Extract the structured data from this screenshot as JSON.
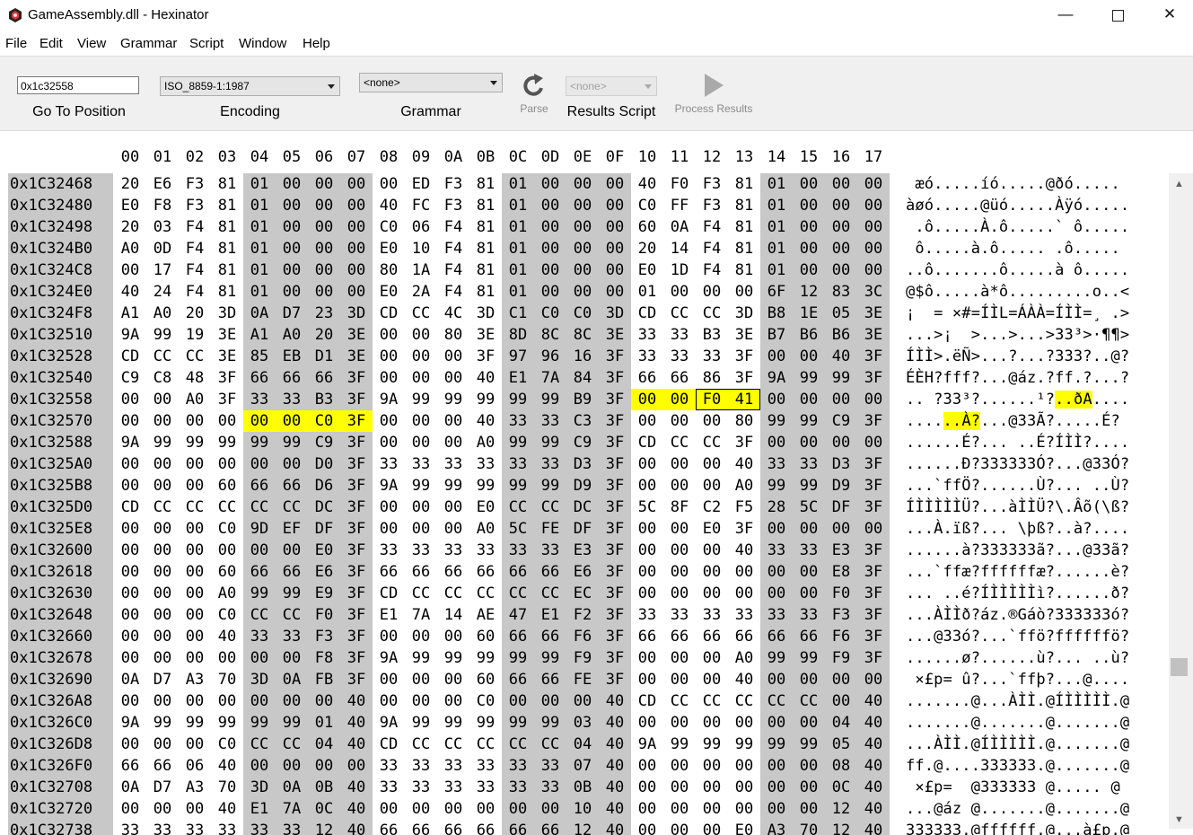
{
  "window": {
    "title": "GameAssembly.dll - Hexinator",
    "minimize": "—",
    "close": "✕"
  },
  "menu": [
    "File",
    "Edit",
    "View",
    "Grammar",
    "Script",
    "Window",
    "Help"
  ],
  "toolbar": {
    "goto_value": "0x1c32558",
    "goto_label": "Go To Position",
    "encoding_value": "ISO_8859-1:1987",
    "encoding_label": "Encoding",
    "grammar_value": "<none>",
    "grammar_label": "Grammar",
    "parse_label": "Parse",
    "results_script_value": "<none>",
    "results_script_label": "Results Script",
    "process_label": "Process Results"
  },
  "hex": {
    "columns": [
      "00",
      "01",
      "02",
      "03",
      "04",
      "05",
      "06",
      "07",
      "08",
      "09",
      "0A",
      "0B",
      "0C",
      "0D",
      "0E",
      "0F",
      "10",
      "11",
      "12",
      "13",
      "14",
      "15",
      "16",
      "17"
    ],
    "rows": [
      {
        "addr": "0x1C32468",
        "bytes": "20 E6 F3 81 01 00 00 00 00 ED F3 81 01 00 00 00 40 F0 F3 81 01 00 00 00",
        "ascii": " æó.....íó.....@ðó....."
      },
      {
        "addr": "0x1C32480",
        "bytes": "E0 F8 F3 81 01 00 00 00 40 FC F3 81 01 00 00 00 C0 FF F3 81 01 00 00 00",
        "ascii": "àøó.....@üó.....Àÿó....."
      },
      {
        "addr": "0x1C32498",
        "bytes": "20 03 F4 81 01 00 00 00 C0 06 F4 81 01 00 00 00 60 0A F4 81 01 00 00 00",
        "ascii": " .ô.....À.ô.....` ô....."
      },
      {
        "addr": "0x1C324B0",
        "bytes": "A0 0D F4 81 01 00 00 00 E0 10 F4 81 01 00 00 00 20 14 F4 81 01 00 00 00",
        "ascii": " ô.....à.ô..... .ô....."
      },
      {
        "addr": "0x1C324C8",
        "bytes": "00 17 F4 81 01 00 00 00 80 1A F4 81 01 00 00 00 E0 1D F4 81 01 00 00 00",
        "ascii": "..ô.......ô.....à ô....."
      },
      {
        "addr": "0x1C324E0",
        "bytes": "40 24 F4 81 01 00 00 00 E0 2A F4 81 01 00 00 00 01 00 00 00 6F 12 83 3C",
        "ascii": "@$ô.....à*ô.........o..<"
      },
      {
        "addr": "0x1C324F8",
        "bytes": "A1 A0 20 3D 0A D7 23 3D CD CC 4C 3D C1 C0 C0 3D CD CC CC 3D B8 1E 05 3E",
        "ascii": "¡  = ×#=ÍÌL=ÁÀÀ=ÍÌÌ=¸ .>"
      },
      {
        "addr": "0x1C32510",
        "bytes": "9A 99 19 3E A1 A0 20 3E 00 00 80 3E 8D 8C 8C 3E 33 33 B3 3E B7 B6 B6 3E",
        "ascii": "...>¡  >...>...>33³>·¶¶>"
      },
      {
        "addr": "0x1C32528",
        "bytes": "CD CC CC 3E 85 EB D1 3E 00 00 00 3F 97 96 16 3F 33 33 33 3F 00 00 40 3F",
        "ascii": "ÍÌÌ>.ëÑ>...?...?333?..@?"
      },
      {
        "addr": "0x1C32540",
        "bytes": "C9 C8 48 3F 66 66 66 3F 00 00 00 40 E1 7A 84 3F 66 66 86 3F 9A 99 99 3F",
        "ascii": "ÉÈH?fff?...@áz.?ff.?...?"
      },
      {
        "addr": "0x1C32558",
        "bytes": "00 00 A0 3F 33 33 B3 3F 9A 99 99 99 99 99 B9 3F 00 00 F0 41 00 00 00 00",
        "ascii": ".. ?33³?......¹?..ðA....",
        "hl": [
          16,
          17,
          18,
          19
        ],
        "box": [
          18,
          19
        ]
      },
      {
        "addr": "0x1C32570",
        "bytes": "00 00 00 00 00 00 C0 3F 00 00 00 40 33 33 C3 3F 00 00 00 80 99 99 C9 3F",
        "ascii": "......À?...@33Ã?.....É?",
        "hl": [
          4,
          5,
          6,
          7
        ]
      },
      {
        "addr": "0x1C32588",
        "bytes": "9A 99 99 99 99 99 C9 3F 00 00 00 A0 99 99 C9 3F CD CC CC 3F 00 00 00 00",
        "ascii": "......É?... ..É?ÍÌÌ?...."
      },
      {
        "addr": "0x1C325A0",
        "bytes": "00 00 00 00 00 00 D0 3F 33 33 33 33 33 33 D3 3F 00 00 00 40 33 33 D3 3F",
        "ascii": "......Ð?333333Ó?...@33Ó?"
      },
      {
        "addr": "0x1C325B8",
        "bytes": "00 00 00 60 66 66 D6 3F 9A 99 99 99 99 99 D9 3F 00 00 00 A0 99 99 D9 3F",
        "ascii": "...`ffÖ?......Ù?... ..Ù?"
      },
      {
        "addr": "0x1C325D0",
        "bytes": "CD CC CC CC CC CC DC 3F 00 00 00 E0 CC CC DC 3F 5C 8F C2 F5 28 5C DF 3F",
        "ascii": "ÍÌÌÌÌÌÜ?...àÌÌÜ?\\.Âõ(\\ß?"
      },
      {
        "addr": "0x1C325E8",
        "bytes": "00 00 00 C0 9D EF DF 3F 00 00 00 A0 5C FE DF 3F 00 00 E0 3F 00 00 00 00",
        "ascii": "...À.ïß?... \\þß?..à?...."
      },
      {
        "addr": "0x1C32600",
        "bytes": "00 00 00 00 00 00 E0 3F 33 33 33 33 33 33 E3 3F 00 00 00 40 33 33 E3 3F",
        "ascii": "......à?333333ã?...@33ã?"
      },
      {
        "addr": "0x1C32618",
        "bytes": "00 00 00 60 66 66 E6 3F 66 66 66 66 66 66 E6 3F 00 00 00 00 00 00 E8 3F",
        "ascii": "...`ffæ?ffffffæ?......è?"
      },
      {
        "addr": "0x1C32630",
        "bytes": "00 00 00 A0 99 99 E9 3F CD CC CC CC CC CC EC 3F 00 00 00 00 00 00 F0 3F",
        "ascii": "... ..é?ÍÌÌÌÌÌì?......ð?"
      },
      {
        "addr": "0x1C32648",
        "bytes": "00 00 00 C0 CC CC F0 3F E1 7A 14 AE 47 E1 F2 3F 33 33 33 33 33 33 F3 3F",
        "ascii": "...ÀÌÌð?áz.®Gáò?333333ó?"
      },
      {
        "addr": "0x1C32660",
        "bytes": "00 00 00 40 33 33 F3 3F 00 00 00 60 66 66 F6 3F 66 66 66 66 66 66 F6 3F",
        "ascii": "...@33ó?...`ffö?ffffffö?"
      },
      {
        "addr": "0x1C32678",
        "bytes": "00 00 00 00 00 00 F8 3F 9A 99 99 99 99 99 F9 3F 00 00 00 A0 99 99 F9 3F",
        "ascii": "......ø?......ù?... ..ù?"
      },
      {
        "addr": "0x1C32690",
        "bytes": "0A D7 A3 70 3D 0A FB 3F 00 00 00 60 66 66 FE 3F 00 00 00 40 00 00 00 00",
        "ascii": " ×£p= û?...`ffþ?...@...."
      },
      {
        "addr": "0x1C326A8",
        "bytes": "00 00 00 00 00 00 00 40 00 00 00 C0 00 00 00 40 CD CC CC CC CC CC 00 40",
        "ascii": ".......@...ÀÌÌ.@ÍÌÌÌÌÌ.@"
      },
      {
        "addr": "0x1C326C0",
        "bytes": "9A 99 99 99 99 99 01 40 9A 99 99 99 99 99 03 40 00 00 00 00 00 00 04 40",
        "ascii": ".......@.......@.......@"
      },
      {
        "addr": "0x1C326D8",
        "bytes": "00 00 00 C0 CC CC 04 40 CD CC CC CC CC CC 04 40 9A 99 99 99 99 99 05 40",
        "ascii": "...ÀÌÌ.@ÍÌÌÌÌÌ.@.......@"
      },
      {
        "addr": "0x1C326F0",
        "bytes": "66 66 06 40 00 00 00 00 33 33 33 33 33 33 07 40 00 00 00 00 00 00 08 40",
        "ascii": "ff.@....333333.@.......@"
      },
      {
        "addr": "0x1C32708",
        "bytes": "0A D7 A3 70 3D 0A 0B 40 33 33 33 33 33 33 0B 40 00 00 00 00 00 00 0C 40",
        "ascii": " ×£p=  @333333 @..... @"
      },
      {
        "addr": "0x1C32720",
        "bytes": "00 00 00 40 E1 7A 0C 40 00 00 00 00 00 00 10 40 00 00 00 00 00 00 12 40",
        "ascii": "...@áz @.......@.......@"
      },
      {
        "addr": "0x1C32738",
        "bytes": "33 33 33 33 33 33 12 40 66 66 66 66 66 66 12 40 00 00 00 E0 A3 70 12 40",
        "ascii": "333333.@ffffff.@...à£p.@"
      }
    ]
  },
  "colors": {
    "highlight": "#ffff00",
    "group_gray": "#c8c8c8"
  }
}
